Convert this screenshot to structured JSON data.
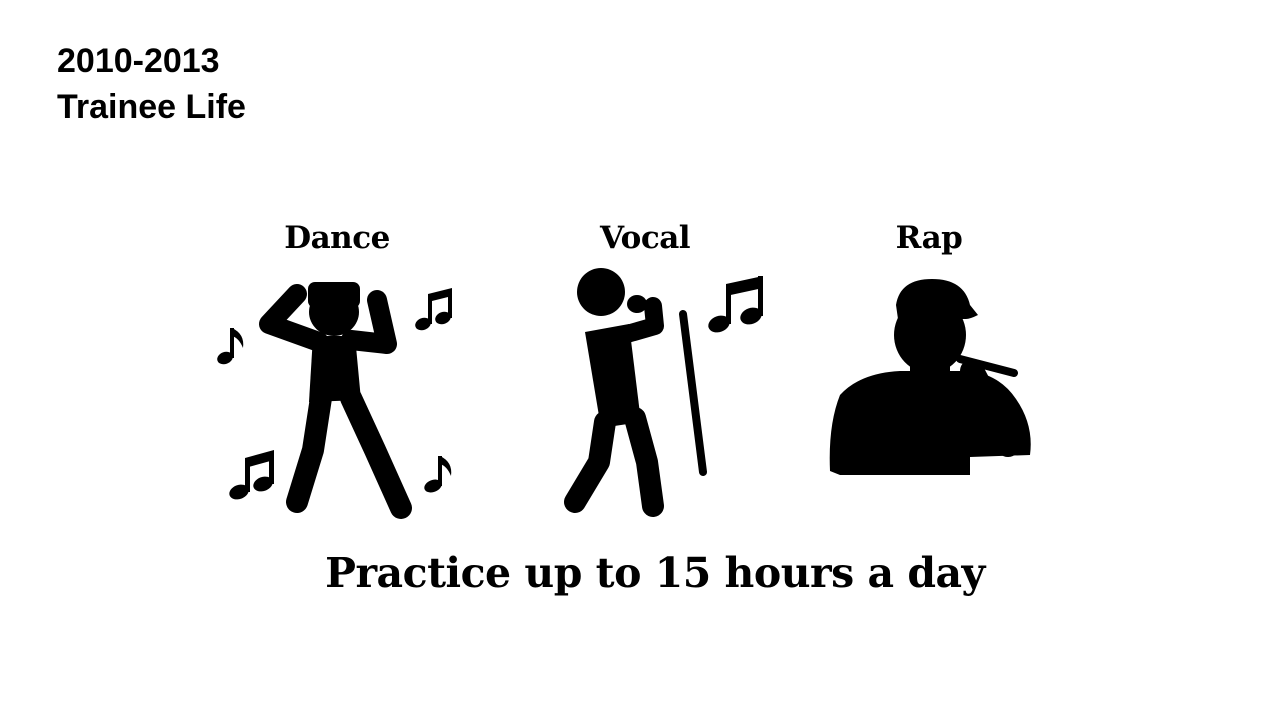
{
  "header": {
    "years": "2010-2013",
    "title": "Trainee Life"
  },
  "categories": [
    {
      "label": "Dance",
      "icon": "dancer-icon"
    },
    {
      "label": "Vocal",
      "icon": "singer-icon"
    },
    {
      "label": "Rap",
      "icon": "rapper-icon"
    }
  ],
  "tagline": "Practice up to 15 hours a day",
  "colors": {
    "background": "#ffffff",
    "foreground": "#000000"
  }
}
